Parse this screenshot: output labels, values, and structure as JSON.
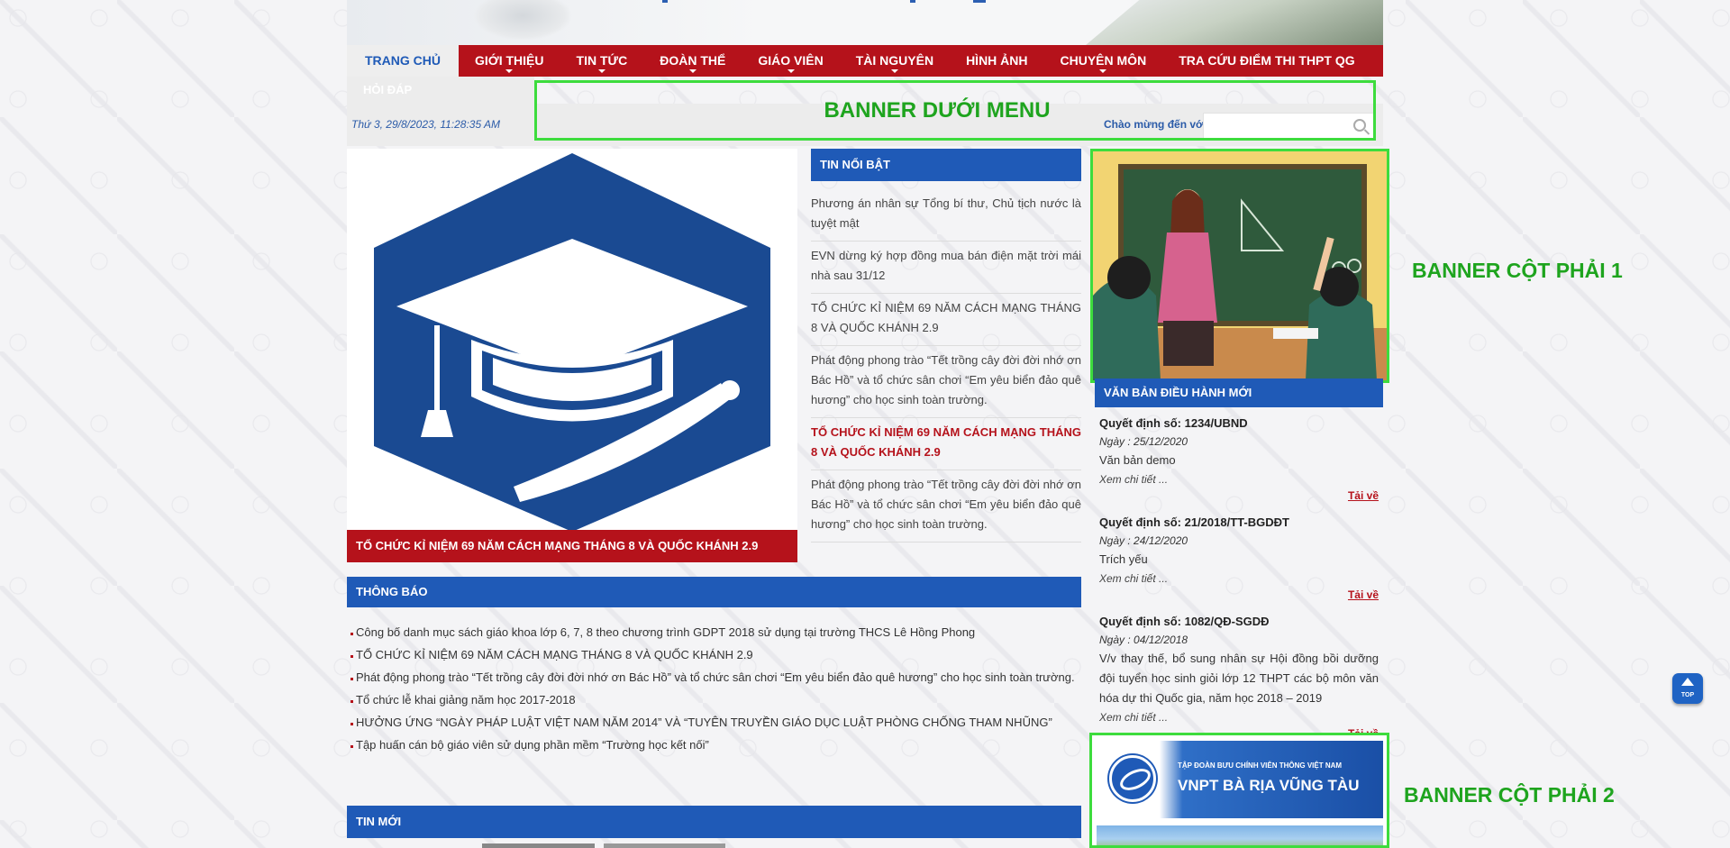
{
  "nav": {
    "items": [
      {
        "label": "TRANG CHỦ",
        "active": true,
        "dropdown": false
      },
      {
        "label": "GIỚI THIỆU",
        "active": false,
        "dropdown": true
      },
      {
        "label": "TIN TỨC",
        "active": false,
        "dropdown": true
      },
      {
        "label": "ĐOÀN THỂ",
        "active": false,
        "dropdown": true
      },
      {
        "label": "GIÁO VIÊN",
        "active": false,
        "dropdown": true
      },
      {
        "label": "TÀI NGUYÊN",
        "active": false,
        "dropdown": true
      },
      {
        "label": "HÌNH ẢNH",
        "active": false,
        "dropdown": false
      },
      {
        "label": "CHUYÊN MÔN",
        "active": false,
        "dropdown": true
      },
      {
        "label": "TRA CỨU ĐIỂM THI THPT QG",
        "active": false,
        "dropdown": false
      }
    ],
    "row2_label": "HỎI ĐÁP"
  },
  "info_strip": {
    "date": "Thứ 3, 29/8/2023, 11:28:35 AM",
    "welcome": "Chào mừng đến với",
    "search_placeholder": ""
  },
  "banner_under_menu": "BANNER DƯỚI MENU",
  "feature": {
    "caption": "TỔ CHỨC KỈ NIỆM 69 NĂM CÁCH MẠNG THÁNG 8 VÀ QUỐC KHÁNH 2.9",
    "image_icon": "graduation-cap-icon"
  },
  "tin_noi_bat": {
    "title": "TIN NỔI BẬT",
    "items": [
      {
        "text": "Phương án nhân sự Tổng bí thư, Chủ tịch nước là tuyệt mật",
        "highlight": false
      },
      {
        "text": "EVN dừng ký hợp đồng mua bán điện mặt trời mái nhà sau 31/12",
        "highlight": false
      },
      {
        "text": "TỔ CHỨC KỈ NIỆM 69 NĂM CÁCH MẠNG THÁNG 8 VÀ QUỐC KHÁNH 2.9",
        "highlight": false
      },
      {
        "text": "Phát động phong trào “Tết trồng cây đời đời nhớ ơn Bác Hồ” và tổ chức sân chơi “Em yêu biển đảo quê hương” cho học sinh toàn trường.",
        "highlight": false
      },
      {
        "text": "TỔ CHỨC KỈ NIỆM 69 NĂM CÁCH MẠNG THÁNG 8 VÀ QUỐC KHÁNH 2.9",
        "highlight": true
      },
      {
        "text": "Phát động phong trào “Tết trồng cây đời đời nhớ ơn Bác Hồ” và tổ chức sân chơi “Em yêu biển đảo quê hương” cho học sinh toàn trường.",
        "highlight": false
      }
    ]
  },
  "thong_bao": {
    "title": "THÔNG BÁO",
    "items": [
      "Công bố danh mục sách giáo khoa lớp 6, 7, 8 theo chương trình GDPT 2018 sử dụng tại trường THCS Lê Hồng Phong",
      "TỔ CHỨC KỈ NIỆM 69 NĂM CÁCH MẠNG THÁNG 8 VÀ QUỐC KHÁNH 2.9",
      "Phát động phong trào “Tết trồng cây đời đời nhớ ơn Bác Hồ” và tổ chức sân chơi “Em yêu biển đảo quê hương” cho học sinh toàn trường.",
      "Tổ chức lễ khai giảng năm học 2017-2018",
      "HƯỞNG ỨNG “NGÀY PHÁP LUẬT VIỆT NAM NĂM 2014” VÀ “TUYÊN TRUYỀN GIÁO DỤC LUẬT PHÒNG CHỐNG THAM NHŨNG”",
      "Tập huấn cán bộ giáo viên sử dụng phần mềm “Trường học kết nối”"
    ]
  },
  "tin_moi": {
    "title": "TIN MỚI"
  },
  "right_banner_1_label": "BANNER CỘT PHẢI 1",
  "right_banner_2_label": "BANNER CỘT PHẢI 2",
  "van_ban": {
    "title": "VĂN BẢN ĐIỀU HÀNH MỚI",
    "items": [
      {
        "title": "Quyết định số: 1234/UBND",
        "date": "Ngày : 25/12/2020",
        "desc": "Văn bản demo",
        "more": "Xem chi tiết ...",
        "download": "Tải về"
      },
      {
        "title": "Quyết định số: 21/2018/TT-BGDĐT",
        "date": "Ngày : 24/12/2020",
        "desc": "Trích yếu",
        "more": "Xem chi tiết ...",
        "download": "Tải về"
      },
      {
        "title": "Quyết định số: 1082/QĐ-SGDĐ",
        "date": "Ngày : 04/12/2018",
        "desc": "V/v thay thế, bổ sung nhân sự Hội đồng bồi dưỡng đội tuyển học sinh giỏi lớp 12 THPT các bộ môn văn hóa dự thi Quốc gia, năm học 2018 – 2019",
        "more": "Xem chi tiết ...",
        "download": "Tải về"
      }
    ]
  },
  "vnpt": {
    "small": "TẬP ĐOÀN BƯU CHÍNH VIỄN THÔNG VIỆT NAM",
    "big": "VNPT BÀ RỊA VŨNG TÀU"
  },
  "top_button_label": "TOP",
  "colors": {
    "nav_red": "#b5121b",
    "section_blue": "#1f5ab7",
    "banner_green": "#3ddc3d"
  }
}
